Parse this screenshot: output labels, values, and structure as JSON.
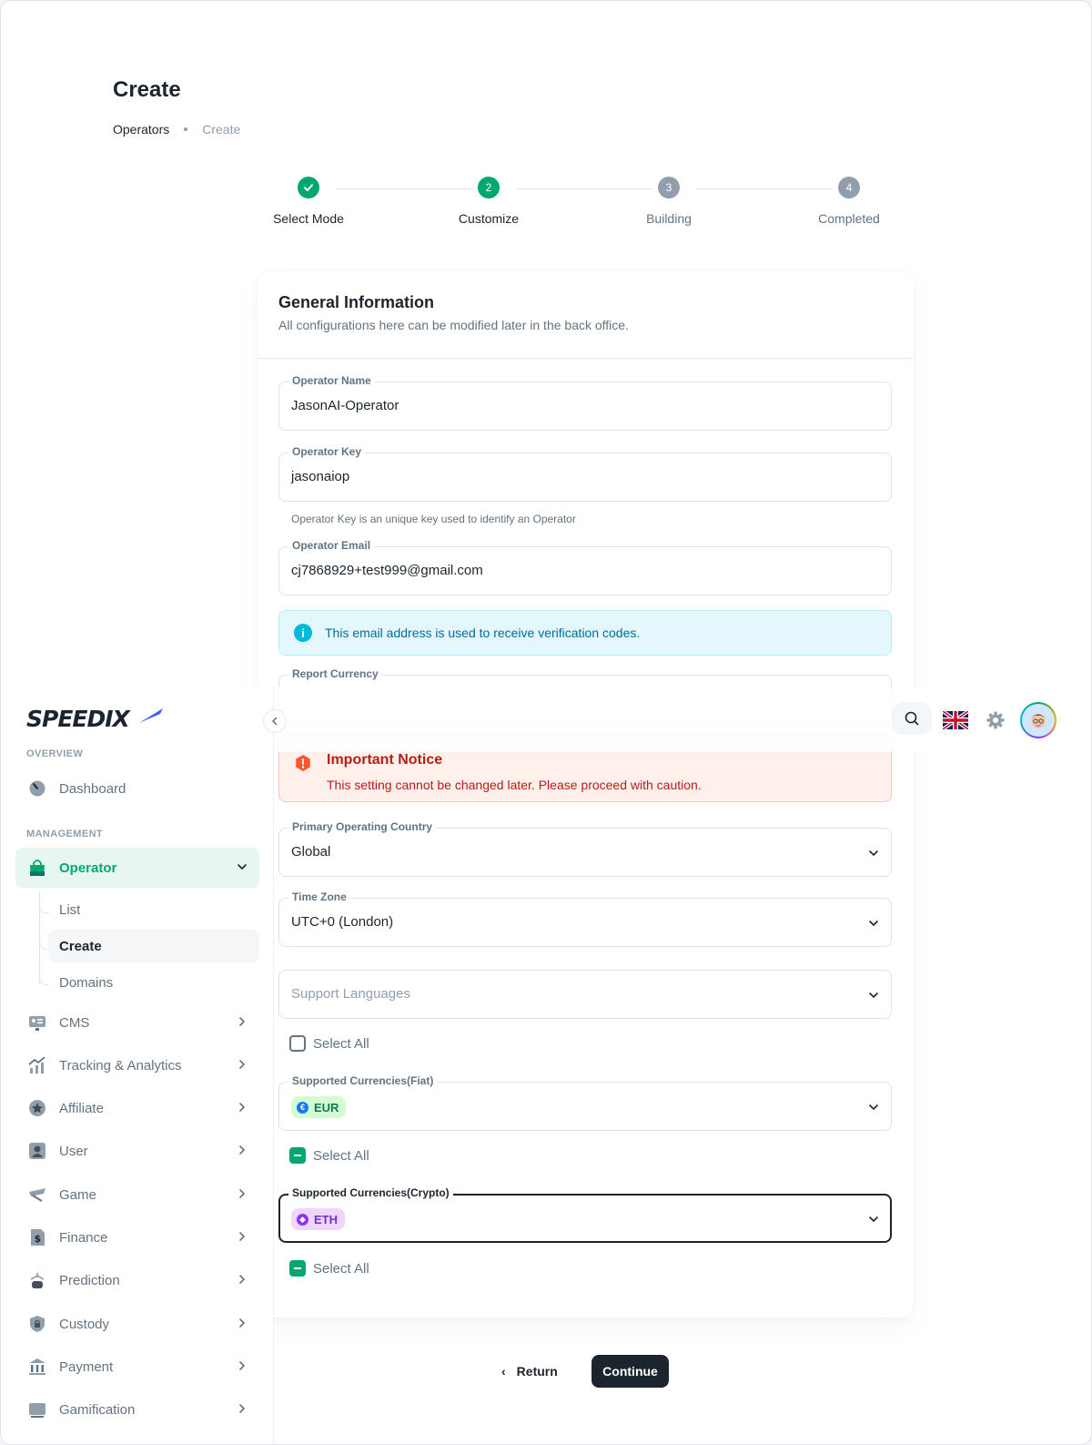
{
  "header": {
    "title": "Create",
    "breadcrumb": {
      "parent": "Operators",
      "current": "Create"
    }
  },
  "stepper": {
    "steps": [
      {
        "label": "Select Mode",
        "number": "1",
        "state": "done"
      },
      {
        "label": "Customize",
        "number": "2",
        "state": "active"
      },
      {
        "label": "Building",
        "number": "3",
        "state": "pending"
      },
      {
        "label": "Completed",
        "number": "4",
        "state": "pending"
      }
    ]
  },
  "form": {
    "title": "General Information",
    "subtitle": "All configurations here can be modified later in the back office.",
    "operator_name": {
      "label": "Operator Name",
      "value": "JasonAI-Operator"
    },
    "operator_key": {
      "label": "Operator Key",
      "value": "jasonaiop",
      "helper": "Operator Key is an unique key used to identify an Operator"
    },
    "operator_email": {
      "label": "Operator Email",
      "value": "cj7868929+test999@gmail.com"
    },
    "email_notice": "This email address is used to receive verification codes.",
    "report_currency": {
      "label": "Report Currency"
    },
    "important_notice": {
      "title": "Important Notice",
      "message": "This setting cannot be changed later. Please proceed with caution."
    },
    "primary_country": {
      "label": "Primary Operating Country",
      "value": "Global"
    },
    "time_zone": {
      "label": "Time Zone",
      "value": "UTC+0 (London)"
    },
    "support_languages": {
      "placeholder": "Support Languages",
      "select_all": "Select All"
    },
    "fiat": {
      "label": "Supported Currencies(Fiat)",
      "chip": "EUR",
      "select_all": "Select All"
    },
    "crypto": {
      "label": "Supported Currencies(Crypto)",
      "chip": "ETH",
      "select_all": "Select All"
    }
  },
  "actions": {
    "return_label": "Return",
    "continue_label": "Continue"
  },
  "sidebar": {
    "logo_text": "SPEEDIX",
    "overview_title": "OVERVIEW",
    "management_title": "MANAGEMENT",
    "dashboard": "Dashboard",
    "operator": "Operator",
    "operator_sub": [
      "List",
      "Create",
      "Domains"
    ],
    "items": [
      "CMS",
      "Tracking & Analytics",
      "Affiliate",
      "User",
      "Game",
      "Finance",
      "Prediction",
      "Custody",
      "Payment",
      "Gamification"
    ]
  },
  "colors": {
    "primary": "#00a76f",
    "dark": "#1c252e",
    "info": "#00b8d9",
    "error": "#b71d18"
  }
}
